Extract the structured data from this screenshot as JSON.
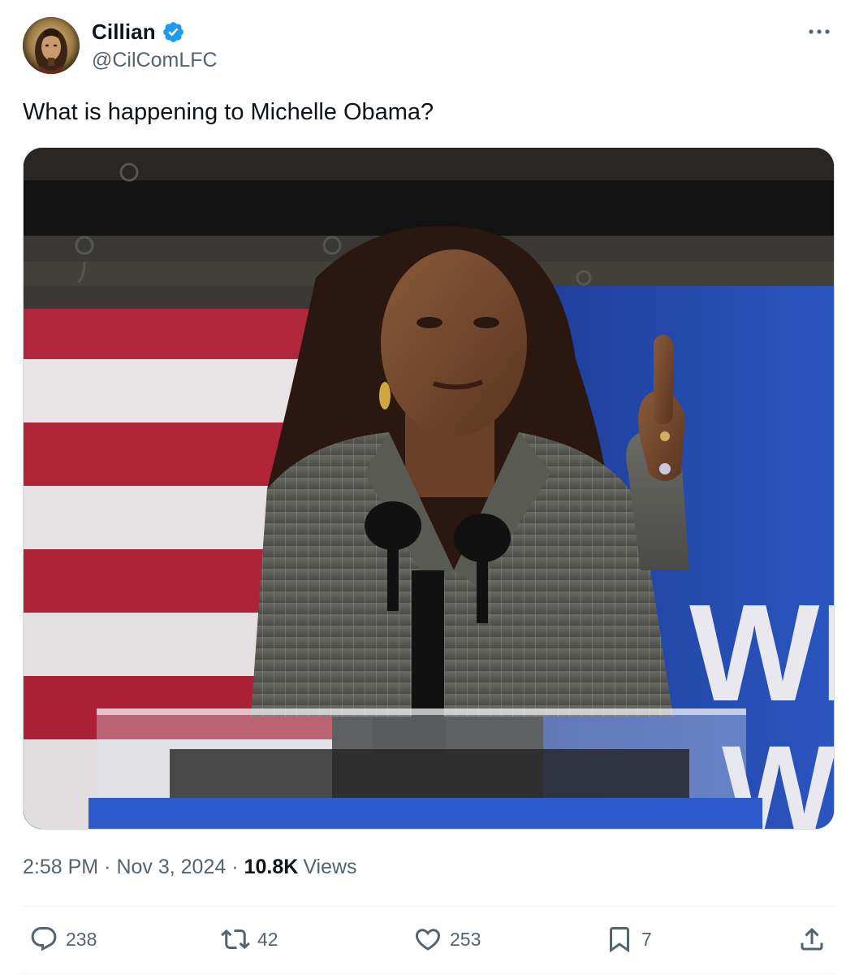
{
  "author": {
    "display_name": "Cillian",
    "handle": "@CilComLFC",
    "verified": true,
    "verified_color": "#1d9bf0"
  },
  "tweet": {
    "text": "What is happening to Michelle Obama?"
  },
  "media": {
    "icon": "photo",
    "banner_letters": [
      "WH",
      "W"
    ]
  },
  "meta": {
    "time": "2:58 PM",
    "separator": "·",
    "date": "Nov 3, 2024",
    "views_count": "10.8K",
    "views_label": "Views"
  },
  "actions": {
    "replies": "238",
    "reposts": "42",
    "likes": "253",
    "bookmarks": "7"
  },
  "icons": {
    "reply": "speech-bubble-icon",
    "repost": "repost-arrows-icon",
    "like": "heart-icon",
    "bookmark": "bookmark-icon",
    "share": "share-upload-icon",
    "more": "more-dots-icon",
    "verified": "verified-badge-icon"
  }
}
